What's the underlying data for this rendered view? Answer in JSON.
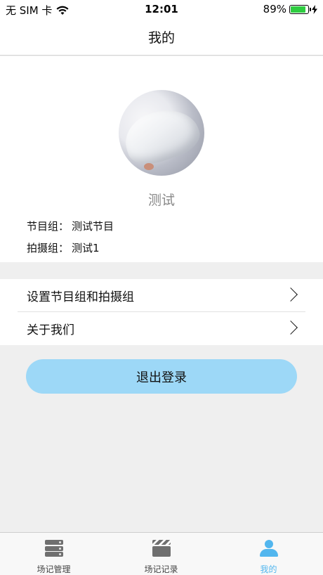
{
  "status_bar": {
    "carrier": "无 SIM 卡",
    "time": "12:01",
    "battery": "89%",
    "battery_level": 0.89
  },
  "nav": {
    "title": "我的"
  },
  "profile": {
    "nickname": "测试",
    "program_group_label": "节目组：",
    "program_group_value": "测试节目",
    "shooting_group_label": "拍摄组：",
    "shooting_group_value": "测试1"
  },
  "menu": {
    "items": [
      {
        "label": "设置节目组和拍摄组"
      },
      {
        "label": "关于我们"
      }
    ]
  },
  "logout": {
    "label": "退出登录"
  },
  "tabs": [
    {
      "label": "场记管理",
      "icon": "server-icon"
    },
    {
      "label": "场记记录",
      "icon": "clapperboard-icon"
    },
    {
      "label": "我的",
      "icon": "user-icon"
    }
  ],
  "colors": {
    "accent": "#52b6ee",
    "logout_bg": "#9dd8f7",
    "battery": "#2ecc40"
  }
}
